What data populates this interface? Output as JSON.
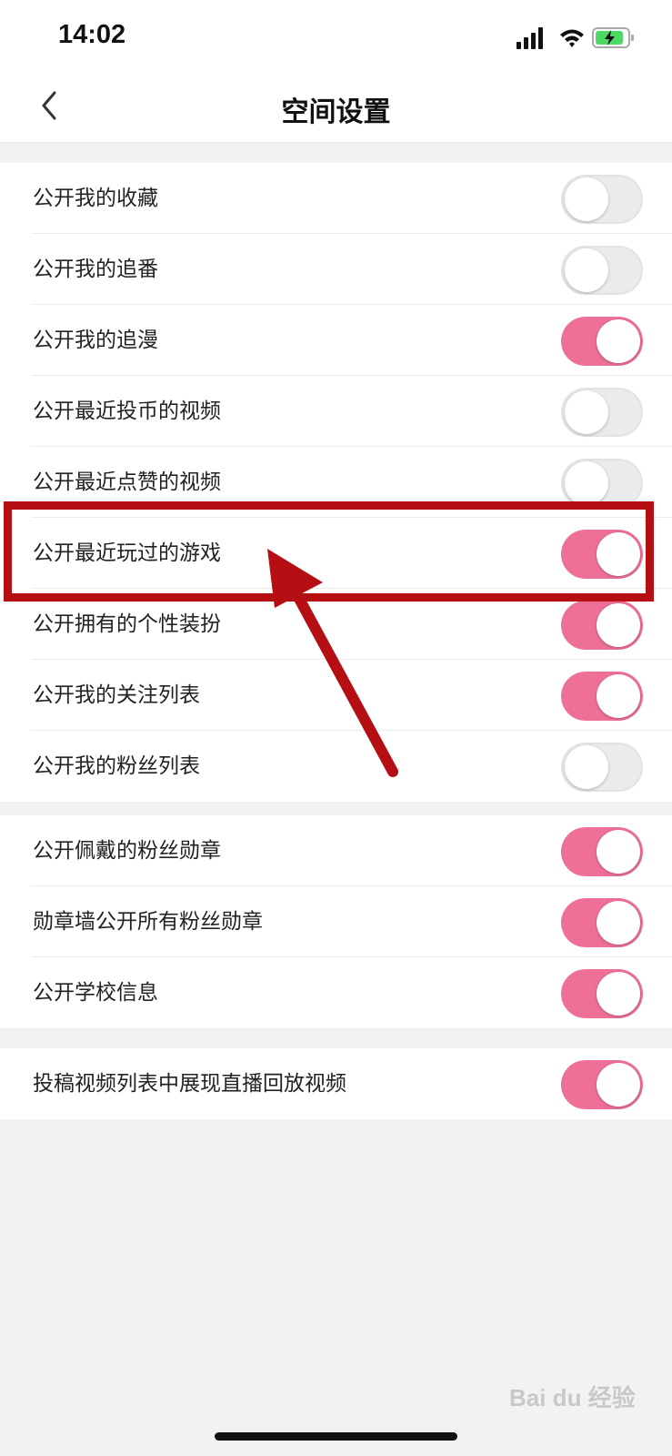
{
  "status_bar": {
    "time": "14:02",
    "icons": [
      "signal-icon",
      "wifi-icon",
      "battery-charging-icon"
    ]
  },
  "nav": {
    "title": "空间设置",
    "back_icon": "chevron-left-icon"
  },
  "groups": [
    {
      "rows": [
        {
          "label": "公开我的收藏",
          "enabled": false
        },
        {
          "label": "公开我的追番",
          "enabled": false
        },
        {
          "label": "公开我的追漫",
          "enabled": true
        },
        {
          "label": "公开最近投币的视频",
          "enabled": false
        },
        {
          "label": "公开最近点赞的视频",
          "enabled": false
        },
        {
          "label": "公开最近玩过的游戏",
          "enabled": true
        },
        {
          "label": "公开拥有的个性装扮",
          "enabled": true
        },
        {
          "label": "公开我的关注列表",
          "enabled": true
        },
        {
          "label": "公开我的粉丝列表",
          "enabled": false
        }
      ]
    },
    {
      "rows": [
        {
          "label": "公开佩戴的粉丝勋章",
          "enabled": true
        },
        {
          "label": "勋章墙公开所有粉丝勋章",
          "enabled": true
        },
        {
          "label": "公开学校信息",
          "enabled": true
        }
      ]
    },
    {
      "rows": [
        {
          "label": "投稿视频列表中展现直播回放视频",
          "enabled": true
        }
      ]
    }
  ],
  "watermark": "Bai du 经验",
  "colors": {
    "toggle_on": "#ee7097",
    "toggle_off": "#ebebeb",
    "annotation": "#b50f14",
    "background": "#f1f2f4"
  }
}
